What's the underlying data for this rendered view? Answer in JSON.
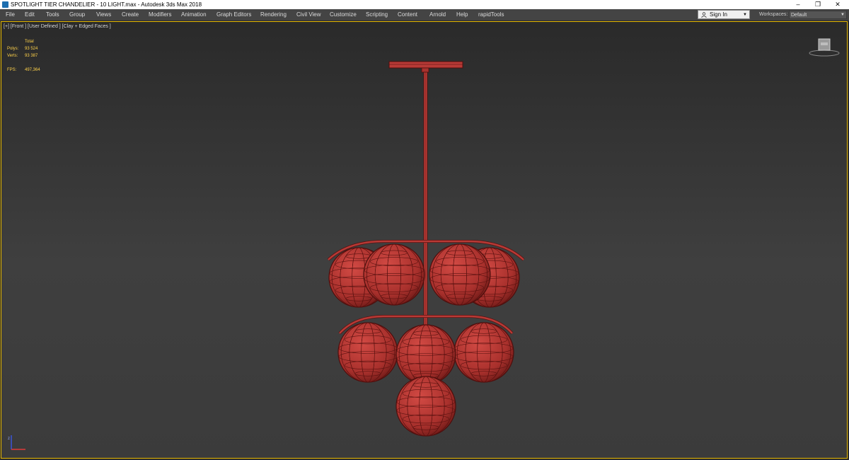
{
  "titlebar": {
    "title": "SPOTLIGHT TIER CHANDELIER - 10 LIGHT.max - Autodesk 3ds Max 2018",
    "minimize": "–",
    "maximize": "❐",
    "close": "✕"
  },
  "menubar": {
    "items": [
      "File",
      "Edit",
      "Tools",
      "Group",
      "Views",
      "Create",
      "Modifiers",
      "Animation",
      "Graph Editors",
      "Rendering",
      "Civil View",
      "Customize",
      "Scripting",
      "Content",
      "Arnold",
      "Help",
      "rapidTools"
    ],
    "sign_in": "Sign In",
    "workspaces_label": "Workspaces:",
    "workspaces_value": "Default"
  },
  "viewport": {
    "label": "[+] [Front ] [User Defined ] [Clay + Edged Faces ]",
    "stats": {
      "header": "Total",
      "polys_label": "Polys:",
      "polys": "93 524",
      "verts_label": "Verts:",
      "verts": "93 387",
      "fps_label": "FPS:",
      "fps": "497,364"
    }
  },
  "colors": {
    "clay": "#b83a36",
    "clay_dark": "#5a1210",
    "viewport_border": "#e6b800",
    "stats_text": "#ffd24a"
  },
  "icons": {
    "app": "3ds-max-logo-icon",
    "user": "user-icon",
    "viewcube": "viewcube-icon",
    "axis": "axis-tripod-icon"
  }
}
